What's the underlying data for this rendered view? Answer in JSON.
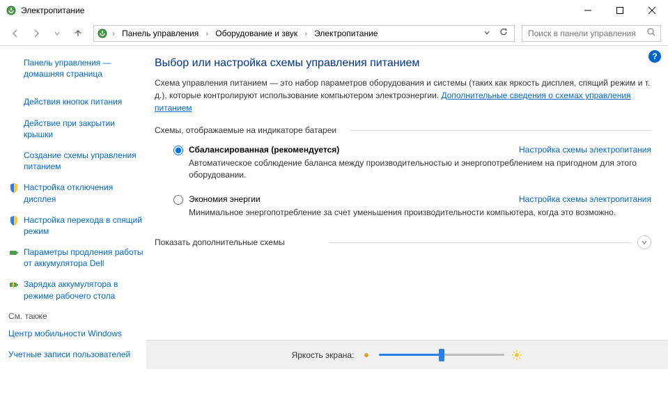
{
  "window": {
    "title": "Электропитание"
  },
  "breadcrumb": {
    "root": "Панель управления",
    "mid": "Оборудование и звук",
    "current": "Электропитание"
  },
  "search": {
    "placeholder": "Поиск в панели управления"
  },
  "sidebar": {
    "home": "Панель управления — домашняя страница",
    "links": [
      "Действия кнопок питания",
      "Действие при закрытии крышки",
      "Создание схемы управления питанием",
      "Настройка отключения дисплея",
      "Настройка перехода в спящий режим",
      "Параметры продления работы от аккумулятора Dell",
      "Зарядка аккумулятора в режиме рабочего стола"
    ],
    "see_also_heading": "См. также",
    "see_also": [
      "Центр мобильности Windows",
      "Учетные записи пользователей"
    ]
  },
  "main": {
    "heading": "Выбор или настройка схемы управления питанием",
    "description_pre": "Схема управления питанием — это набор параметров оборудования и системы (таких как яркость дисплея, спящий режим и т. д.), которые контролируют использование компьютером электроэнергии. ",
    "description_link": "Дополнительные сведения о схемах управления питанием",
    "group_label": "Схемы, отображаемые на индикаторе батареи",
    "plans": [
      {
        "name": "Сбалансированная (рекомендуется)",
        "selected": true,
        "settings_link": "Настройка схемы электропитания",
        "desc": "Автоматическое соблюдение баланса между производительностью и энергопотреблением на пригодном для этого оборудовании."
      },
      {
        "name": "Экономия энергии",
        "selected": false,
        "settings_link": "Настройка схемы электропитания",
        "desc": "Минимальное энергопотребление за счет уменьшения производительности компьютера, когда это возможно."
      }
    ],
    "expander": "Показать дополнительные схемы",
    "brightness_label": "Яркость экрана:"
  }
}
